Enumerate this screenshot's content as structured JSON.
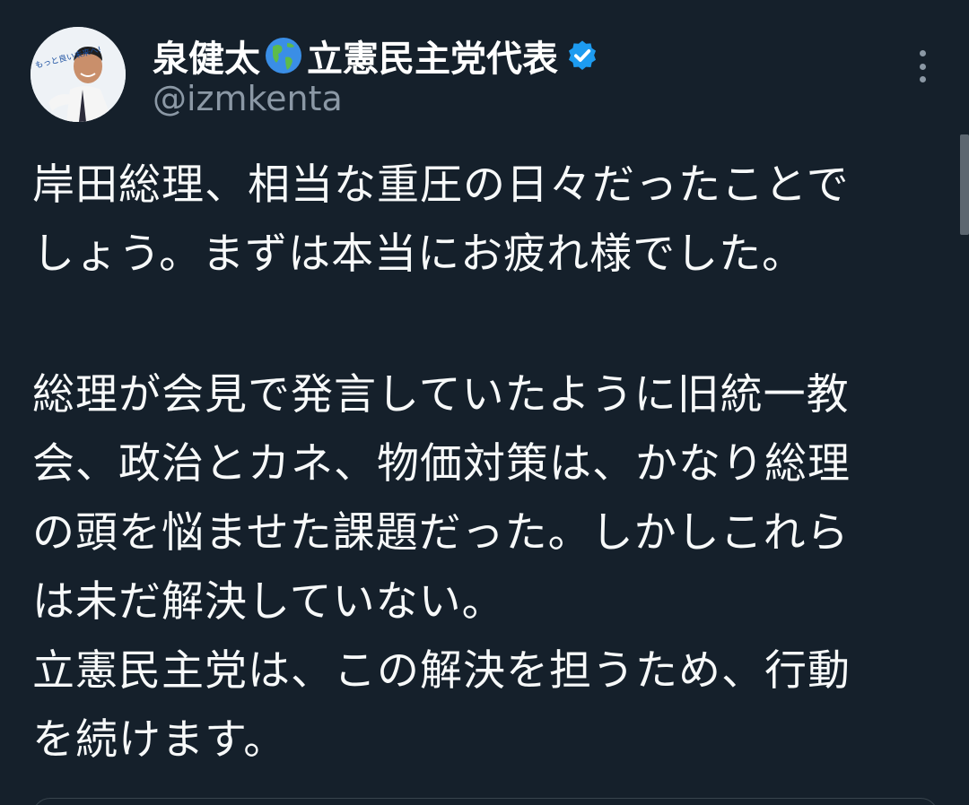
{
  "tweet": {
    "author": {
      "display_name": "泉健太",
      "globe_emoji": "earth-globe-americas-icon",
      "display_name_suffix": "立憲民主党代表",
      "handle": "@izmkenta",
      "verified": true,
      "avatar_text": "もっと良い未来へ!"
    },
    "paragraphs": [
      [
        "岸田総理、相当な重圧の日々だったことで",
        "しょう。まずは本当にお疲れ様でした。"
      ],
      [
        "総理が会見で発言していたように旧統一教",
        "会、政治とカネ、物価対策は、かなり総理",
        "の頭を悩ませた課題だった。しかしこれら",
        "は未だ解決していない。",
        "立憲民主党は、この解決を担うため、行動",
        "を続けます。"
      ]
    ]
  },
  "colors": {
    "background": "#15202b",
    "text": "#f7f9f9",
    "secondary": "#8b98a5",
    "verified": "#1d9bf0"
  }
}
